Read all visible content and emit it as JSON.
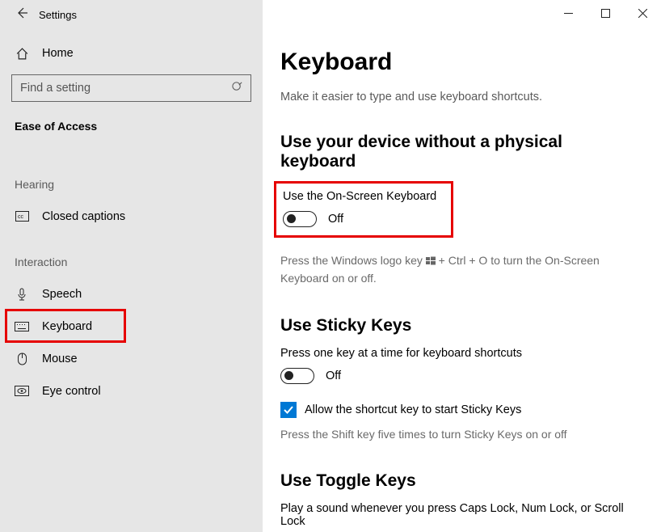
{
  "window": {
    "title": "Settings"
  },
  "sidebar": {
    "home": "Home",
    "search_placeholder": "Find a setting",
    "section": "Ease of Access",
    "group_hearing": "Hearing",
    "group_interaction": "Interaction",
    "items": {
      "closed_captions": "Closed captions",
      "speech": "Speech",
      "keyboard": "Keyboard",
      "mouse": "Mouse",
      "eye_control": "Eye control"
    }
  },
  "content": {
    "title": "Keyboard",
    "subtitle": "Make it easier to type and use keyboard shortcuts.",
    "section1": {
      "heading": "Use your device without a physical keyboard",
      "osk_label": "Use the On-Screen Keyboard",
      "toggle_state": "Off",
      "hint_pre": "Press the Windows logo key ",
      "hint_post": " + Ctrl + O to turn the On-Screen Keyboard on or off."
    },
    "section2": {
      "heading": "Use Sticky Keys",
      "body": "Press one key at a time for keyboard shortcuts",
      "toggle_state": "Off",
      "checkbox_label": "Allow the shortcut key to start Sticky Keys",
      "hint": "Press the Shift key five times to turn Sticky Keys on or off"
    },
    "section3": {
      "heading": "Use Toggle Keys",
      "body": "Play a sound whenever you press Caps Lock, Num Lock, or Scroll Lock"
    }
  }
}
